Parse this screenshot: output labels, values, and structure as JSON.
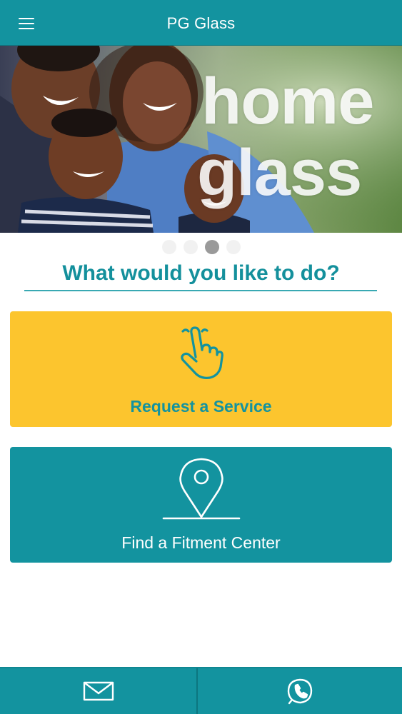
{
  "header": {
    "title": "PG Glass",
    "menu_icon": "hamburger-menu-icon"
  },
  "banner": {
    "text_line1": "home",
    "text_line2": "glass",
    "carousel": {
      "slide_count": 4,
      "active_index": 2
    }
  },
  "main": {
    "prompt": "What would you like to do?",
    "actions": [
      {
        "label": "Request a Service",
        "icon": "pointing-hand-icon",
        "background": "#fcc52e",
        "text_color": "#13939f"
      },
      {
        "label": "Find a Fitment Center",
        "icon": "location-pin-icon",
        "background": "#13939f",
        "text_color": "#ffffff"
      }
    ]
  },
  "bottom_bar": {
    "items": [
      {
        "icon": "mail-icon"
      },
      {
        "icon": "phone-icon"
      }
    ]
  },
  "colors": {
    "brand_teal": "#13939f",
    "accent_yellow": "#fcc52e"
  }
}
